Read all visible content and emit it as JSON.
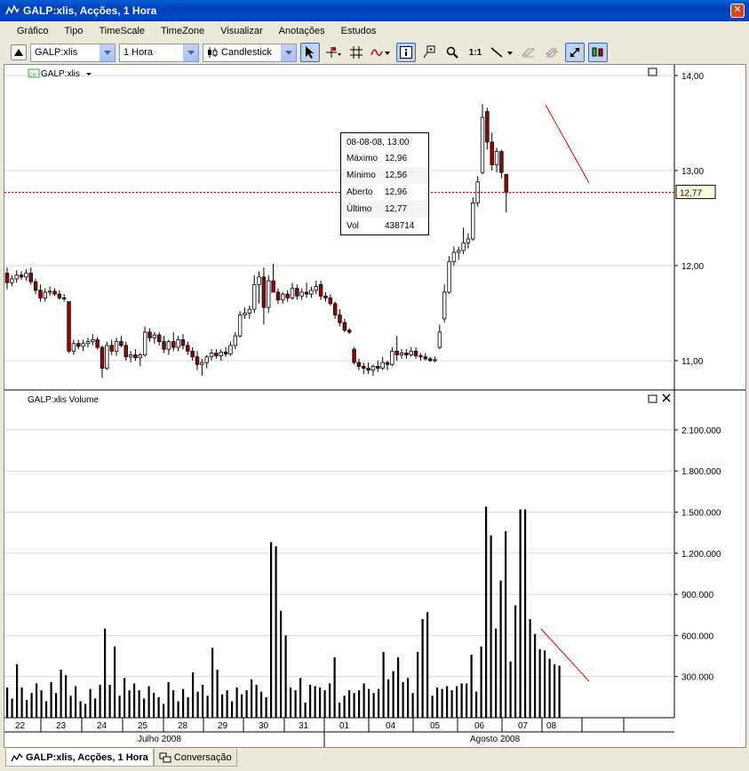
{
  "window": {
    "title": "GALP:xlis, Acções, 1 Hora"
  },
  "menu": [
    "Gráfico",
    "Tipo",
    "TimeScale",
    "TimeZone",
    "Visualizar",
    "Anotações",
    "Estudos"
  ],
  "toolbar": {
    "symbol": "GALP:xlis",
    "interval": "1 Hora",
    "chart_type": "Candlestick",
    "one_to_one": "1:1"
  },
  "price_panel": {
    "legend": "GALP:xlis",
    "legend_badge": "co",
    "last_price_label": "12,77",
    "y_ticks": [
      "14,00",
      "13,00",
      "12,00",
      "11,00"
    ]
  },
  "volume_panel": {
    "legend": "GALP:xlis Volume",
    "y_ticks": [
      "2.100.000",
      "1.800.000",
      "1.500.000",
      "1.200.000",
      "900.000",
      "600.000",
      "300.000"
    ]
  },
  "x_axis": {
    "days": [
      "22",
      "23",
      "24",
      "25",
      "28",
      "29",
      "30",
      "31",
      "01",
      "04",
      "05",
      "06",
      "07",
      "08"
    ],
    "months": [
      "Julho 2008",
      "Agosto 2008"
    ]
  },
  "tooltip": {
    "header": "08-08-08, 13:00",
    "rows": [
      {
        "k": "Máximo",
        "v": "12,96"
      },
      {
        "k": "Mínimo",
        "v": "12,56"
      },
      {
        "k": "Aberto",
        "v": "12,96"
      },
      {
        "k": "Último",
        "v": "12,77"
      },
      {
        "k": "Vol",
        "v": "438714"
      }
    ]
  },
  "tabs": [
    {
      "label": "GALP:xlis, Acções, 1 Hora",
      "active": true
    },
    {
      "label": "Conversação",
      "active": false
    }
  ],
  "chart_data": [
    {
      "type": "candlestick",
      "title": "GALP:xlis",
      "ylim": [
        10.7,
        14.1
      ],
      "yticks": [
        11,
        12,
        13,
        14
      ],
      "last_price": 12.77,
      "candles": [
        {
          "o": 11.92,
          "h": 11.98,
          "l": 11.75,
          "c": 11.82
        },
        {
          "o": 11.82,
          "h": 11.9,
          "l": 11.78,
          "c": 11.86
        },
        {
          "o": 11.86,
          "h": 11.95,
          "l": 11.82,
          "c": 11.9
        },
        {
          "o": 11.9,
          "h": 11.94,
          "l": 11.85,
          "c": 11.88
        },
        {
          "o": 11.88,
          "h": 11.96,
          "l": 11.84,
          "c": 11.92
        },
        {
          "o": 11.92,
          "h": 11.98,
          "l": 11.8,
          "c": 11.83
        },
        {
          "o": 11.83,
          "h": 11.86,
          "l": 11.7,
          "c": 11.74
        },
        {
          "o": 11.74,
          "h": 11.8,
          "l": 11.62,
          "c": 11.66
        },
        {
          "o": 11.66,
          "h": 11.76,
          "l": 11.62,
          "c": 11.72
        },
        {
          "o": 11.72,
          "h": 11.78,
          "l": 11.68,
          "c": 11.73
        },
        {
          "o": 11.73,
          "h": 11.76,
          "l": 11.68,
          "c": 11.7
        },
        {
          "o": 11.7,
          "h": 11.74,
          "l": 11.64,
          "c": 11.66
        },
        {
          "o": 11.66,
          "h": 11.7,
          "l": 11.62,
          "c": 11.65
        },
        {
          "o": 11.62,
          "h": 11.62,
          "l": 11.08,
          "c": 11.1
        },
        {
          "o": 11.1,
          "h": 11.22,
          "l": 11.06,
          "c": 11.18
        },
        {
          "o": 11.18,
          "h": 11.22,
          "l": 11.12,
          "c": 11.15
        },
        {
          "o": 11.15,
          "h": 11.22,
          "l": 11.1,
          "c": 11.18
        },
        {
          "o": 11.18,
          "h": 11.24,
          "l": 11.14,
          "c": 11.2
        },
        {
          "o": 11.2,
          "h": 11.28,
          "l": 11.16,
          "c": 11.22
        },
        {
          "o": 11.22,
          "h": 11.25,
          "l": 11.12,
          "c": 11.14
        },
        {
          "o": 11.14,
          "h": 11.16,
          "l": 10.82,
          "c": 10.92
        },
        {
          "o": 10.92,
          "h": 11.2,
          "l": 10.9,
          "c": 11.16
        },
        {
          "o": 11.16,
          "h": 11.22,
          "l": 11.06,
          "c": 11.1
        },
        {
          "o": 11.1,
          "h": 11.24,
          "l": 11.05,
          "c": 11.2
        },
        {
          "o": 11.2,
          "h": 11.26,
          "l": 11.14,
          "c": 11.16
        },
        {
          "o": 11.16,
          "h": 11.2,
          "l": 11.0,
          "c": 11.04
        },
        {
          "o": 11.04,
          "h": 11.1,
          "l": 10.98,
          "c": 11.06
        },
        {
          "o": 11.06,
          "h": 11.12,
          "l": 11.0,
          "c": 11.03
        },
        {
          "o": 11.03,
          "h": 11.08,
          "l": 10.94,
          "c": 11.06
        },
        {
          "o": 11.06,
          "h": 11.36,
          "l": 11.04,
          "c": 11.3
        },
        {
          "o": 11.3,
          "h": 11.34,
          "l": 11.2,
          "c": 11.24
        },
        {
          "o": 11.24,
          "h": 11.3,
          "l": 11.18,
          "c": 11.27
        },
        {
          "o": 11.27,
          "h": 11.3,
          "l": 11.16,
          "c": 11.2
        },
        {
          "o": 11.2,
          "h": 11.26,
          "l": 11.08,
          "c": 11.12
        },
        {
          "o": 11.12,
          "h": 11.22,
          "l": 11.06,
          "c": 11.2
        },
        {
          "o": 11.2,
          "h": 11.3,
          "l": 11.1,
          "c": 11.14
        },
        {
          "o": 11.14,
          "h": 11.26,
          "l": 11.1,
          "c": 11.22
        },
        {
          "o": 11.22,
          "h": 11.28,
          "l": 11.12,
          "c": 11.16
        },
        {
          "o": 11.16,
          "h": 11.2,
          "l": 11.06,
          "c": 11.1
        },
        {
          "o": 11.1,
          "h": 11.14,
          "l": 11.0,
          "c": 11.04
        },
        {
          "o": 11.04,
          "h": 11.1,
          "l": 10.9,
          "c": 10.96
        },
        {
          "o": 10.96,
          "h": 11.02,
          "l": 10.84,
          "c": 10.98
        },
        {
          "o": 10.98,
          "h": 11.06,
          "l": 10.92,
          "c": 11.04
        },
        {
          "o": 11.04,
          "h": 11.12,
          "l": 11.0,
          "c": 11.08
        },
        {
          "o": 11.08,
          "h": 11.12,
          "l": 11.02,
          "c": 11.05
        },
        {
          "o": 11.05,
          "h": 11.12,
          "l": 11.0,
          "c": 11.09
        },
        {
          "o": 11.09,
          "h": 11.14,
          "l": 11.04,
          "c": 11.07
        },
        {
          "o": 11.07,
          "h": 11.2,
          "l": 11.05,
          "c": 11.16
        },
        {
          "o": 11.16,
          "h": 11.3,
          "l": 11.12,
          "c": 11.26
        },
        {
          "o": 11.26,
          "h": 11.52,
          "l": 11.24,
          "c": 11.48
        },
        {
          "o": 11.48,
          "h": 11.56,
          "l": 11.44,
          "c": 11.5
        },
        {
          "o": 11.5,
          "h": 11.58,
          "l": 11.44,
          "c": 11.54
        },
        {
          "o": 11.54,
          "h": 11.9,
          "l": 11.5,
          "c": 11.8
        },
        {
          "o": 11.8,
          "h": 11.94,
          "l": 11.6,
          "c": 11.88
        },
        {
          "o": 11.88,
          "h": 11.98,
          "l": 11.38,
          "c": 11.56
        },
        {
          "o": 11.56,
          "h": 11.9,
          "l": 11.5,
          "c": 11.84
        },
        {
          "o": 11.84,
          "h": 12.02,
          "l": 11.72,
          "c": 11.72
        },
        {
          "o": 11.72,
          "h": 11.76,
          "l": 11.6,
          "c": 11.64
        },
        {
          "o": 11.64,
          "h": 11.72,
          "l": 11.6,
          "c": 11.7
        },
        {
          "o": 11.7,
          "h": 11.74,
          "l": 11.62,
          "c": 11.66
        },
        {
          "o": 11.66,
          "h": 11.82,
          "l": 11.64,
          "c": 11.76
        },
        {
          "o": 11.76,
          "h": 11.8,
          "l": 11.64,
          "c": 11.68
        },
        {
          "o": 11.68,
          "h": 11.76,
          "l": 11.64,
          "c": 11.72
        },
        {
          "o": 11.72,
          "h": 11.82,
          "l": 11.66,
          "c": 11.7
        },
        {
          "o": 11.7,
          "h": 11.78,
          "l": 11.66,
          "c": 11.74
        },
        {
          "o": 11.74,
          "h": 11.84,
          "l": 11.7,
          "c": 11.78
        },
        {
          "o": 11.8,
          "h": 11.84,
          "l": 11.64,
          "c": 11.68
        },
        {
          "o": 11.68,
          "h": 11.72,
          "l": 11.62,
          "c": 11.66
        },
        {
          "o": 11.66,
          "h": 11.7,
          "l": 11.58,
          "c": 11.6
        },
        {
          "o": 11.6,
          "h": 11.62,
          "l": 11.44,
          "c": 11.48
        },
        {
          "o": 11.48,
          "h": 11.54,
          "l": 11.36,
          "c": 11.4
        },
        {
          "o": 11.4,
          "h": 11.44,
          "l": 11.3,
          "c": 11.32
        },
        {
          "o": 11.32,
          "h": 11.34,
          "l": 11.28,
          "c": 11.3
        },
        {
          "o": 11.12,
          "h": 11.14,
          "l": 10.96,
          "c": 10.98
        },
        {
          "o": 10.98,
          "h": 11.02,
          "l": 10.9,
          "c": 10.94
        },
        {
          "o": 10.94,
          "h": 10.98,
          "l": 10.86,
          "c": 10.92
        },
        {
          "o": 10.92,
          "h": 10.98,
          "l": 10.86,
          "c": 10.9
        },
        {
          "o": 10.9,
          "h": 10.96,
          "l": 10.84,
          "c": 10.94
        },
        {
          "o": 10.94,
          "h": 11.0,
          "l": 10.88,
          "c": 10.92
        },
        {
          "o": 10.92,
          "h": 11.04,
          "l": 10.9,
          "c": 10.98
        },
        {
          "o": 10.98,
          "h": 11.0,
          "l": 10.9,
          "c": 10.96
        },
        {
          "o": 10.96,
          "h": 11.14,
          "l": 10.94,
          "c": 11.1
        },
        {
          "o": 11.1,
          "h": 11.26,
          "l": 11.0,
          "c": 11.06
        },
        {
          "o": 11.06,
          "h": 11.12,
          "l": 11.02,
          "c": 11.08
        },
        {
          "o": 11.08,
          "h": 11.12,
          "l": 11.02,
          "c": 11.06
        },
        {
          "o": 11.06,
          "h": 11.14,
          "l": 11.04,
          "c": 11.1
        },
        {
          "o": 11.1,
          "h": 11.14,
          "l": 11.02,
          "c": 11.05
        },
        {
          "o": 11.05,
          "h": 11.08,
          "l": 11.0,
          "c": 11.04
        },
        {
          "o": 11.04,
          "h": 11.08,
          "l": 11.0,
          "c": 11.02
        },
        {
          "o": 11.02,
          "h": 11.04,
          "l": 10.99,
          "c": 11.0
        },
        {
          "o": 11.0,
          "h": 11.04,
          "l": 10.98,
          "c": 11.01
        },
        {
          "o": 11.14,
          "h": 11.38,
          "l": 11.12,
          "c": 11.3
        },
        {
          "o": 11.44,
          "h": 11.8,
          "l": 11.4,
          "c": 11.72
        },
        {
          "o": 11.72,
          "h": 12.1,
          "l": 11.7,
          "c": 12.04
        },
        {
          "o": 12.04,
          "h": 12.2,
          "l": 12.0,
          "c": 12.14
        },
        {
          "o": 12.14,
          "h": 12.2,
          "l": 12.06,
          "c": 12.16
        },
        {
          "o": 12.16,
          "h": 12.4,
          "l": 12.12,
          "c": 12.24
        },
        {
          "o": 12.24,
          "h": 12.34,
          "l": 12.18,
          "c": 12.28
        },
        {
          "o": 12.28,
          "h": 12.72,
          "l": 12.26,
          "c": 12.66
        },
        {
          "o": 12.66,
          "h": 12.94,
          "l": 12.62,
          "c": 12.88
        },
        {
          "o": 12.98,
          "h": 13.7,
          "l": 12.96,
          "c": 13.56
        },
        {
          "o": 13.62,
          "h": 13.66,
          "l": 13.22,
          "c": 13.3
        },
        {
          "o": 13.3,
          "h": 13.4,
          "l": 13.0,
          "c": 13.06
        },
        {
          "o": 13.06,
          "h": 13.24,
          "l": 12.98,
          "c": 13.2
        },
        {
          "o": 13.2,
          "h": 13.22,
          "l": 12.92,
          "c": 12.98
        },
        {
          "o": 12.96,
          "h": 12.96,
          "l": 12.56,
          "c": 12.77
        }
      ]
    },
    {
      "type": "bar",
      "title": "GALP:xlis Volume",
      "ylim": [
        0,
        2300000
      ],
      "yticks": [
        300000,
        600000,
        900000,
        1200000,
        1500000,
        1800000,
        2100000
      ],
      "values": [
        220000,
        140000,
        390000,
        220000,
        130000,
        180000,
        250000,
        200000,
        120000,
        260000,
        180000,
        350000,
        310000,
        160000,
        230000,
        120000,
        100000,
        210000,
        140000,
        240000,
        650000,
        240000,
        520000,
        160000,
        290000,
        200000,
        250000,
        200000,
        140000,
        230000,
        180000,
        150000,
        100000,
        260000,
        200000,
        120000,
        210000,
        150000,
        330000,
        190000,
        240000,
        160000,
        510000,
        350000,
        170000,
        200000,
        120000,
        220000,
        170000,
        200000,
        280000,
        240000,
        190000,
        150000,
        1280000,
        1250000,
        780000,
        600000,
        220000,
        200000,
        290000,
        110000,
        240000,
        230000,
        220000,
        200000,
        250000,
        440000,
        110000,
        160000,
        200000,
        180000,
        200000,
        250000,
        210000,
        180000,
        210000,
        480000,
        280000,
        340000,
        440000,
        260000,
        290000,
        180000,
        480000,
        720000,
        770000,
        160000,
        220000,
        210000,
        230000,
        200000,
        230000,
        250000,
        250000,
        460000,
        190000,
        520000,
        1540000,
        1330000,
        650000,
        1000000,
        1360000,
        410000,
        820000,
        1520000,
        1520000,
        720000,
        610000,
        500000,
        490000,
        430000,
        390000,
        380000
      ]
    }
  ]
}
